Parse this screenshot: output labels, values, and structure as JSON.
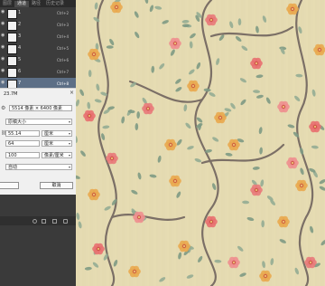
{
  "panel_tabs": [
    "图层",
    "通道",
    "路径",
    "历史记录"
  ],
  "panel_active_tab": 1,
  "channels": [
    {
      "name": "1",
      "shortcut": "Ctrl+2"
    },
    {
      "name": "2",
      "shortcut": "Ctrl+3"
    },
    {
      "name": "3",
      "shortcut": "Ctrl+4"
    },
    {
      "name": "4",
      "shortcut": "Ctrl+5"
    },
    {
      "name": "5",
      "shortcut": "Ctrl+6"
    },
    {
      "name": "6",
      "shortcut": "Ctrl+7"
    },
    {
      "name": "7",
      "shortcut": "Ctrl+8"
    }
  ],
  "dialog": {
    "size_label": "23.7M",
    "dimensions": "5514 像素 × 6400 像素",
    "fit_to": "原稿大小",
    "width_value": "55.14",
    "width_unit": "厘米",
    "height_value": "64",
    "height_unit": "厘米",
    "resolution_value": "100",
    "resolution_unit": "像素/厘米",
    "resample": "自动",
    "ok_label": "",
    "cancel_label": "取消"
  },
  "colors": {
    "canvas_bg": "#e4dbb2",
    "panel_bg": "#3a3a3a",
    "selected_row": "#5d6f86"
  }
}
